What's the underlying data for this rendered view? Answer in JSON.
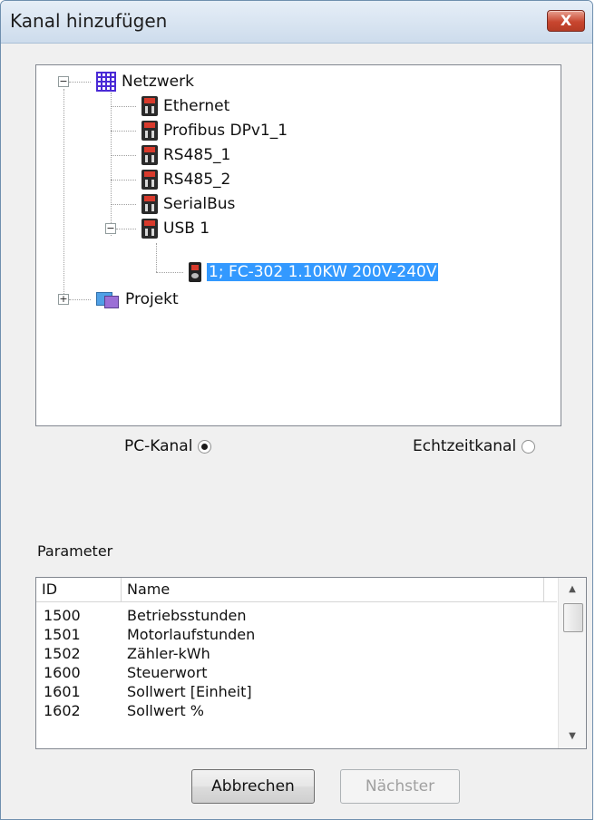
{
  "window": {
    "title": "Kanal hinzufügen",
    "close_glyph": "X"
  },
  "tree": {
    "root": {
      "label": "Netzwerk",
      "expander": "−",
      "icon": "network-grid-icon"
    },
    "channels": [
      "Ethernet",
      "Profibus DPv1_1",
      "RS485_1",
      "RS485_2",
      "SerialBus"
    ],
    "usb": {
      "label": "USB 1",
      "expander": "−"
    },
    "drive": {
      "label": "1; FC-302 1.10KW 200V-240V",
      "selected": true
    },
    "project": {
      "label": "Projekt",
      "expander": "+"
    }
  },
  "radios": {
    "pc": {
      "label": "PC-Kanal",
      "checked": true
    },
    "realtime": {
      "label": "Echtzeitkanal",
      "checked": false
    }
  },
  "parameters": {
    "label": "Parameter",
    "columns": [
      "ID",
      "Name"
    ],
    "rows": [
      [
        "1500",
        "Betriebsstunden"
      ],
      [
        "1501",
        "Motorlaufstunden"
      ],
      [
        "1502",
        "Zähler-kWh"
      ],
      [
        "1600",
        "Steuerwort"
      ],
      [
        "1601",
        "Sollwert [Einheit]"
      ],
      [
        "1602",
        "Sollwert %"
      ]
    ]
  },
  "buttons": {
    "cancel": "Abbrechen",
    "next": "Nächster"
  },
  "colors": {
    "selection": "#3399ff",
    "close_button": "#c8462f"
  }
}
